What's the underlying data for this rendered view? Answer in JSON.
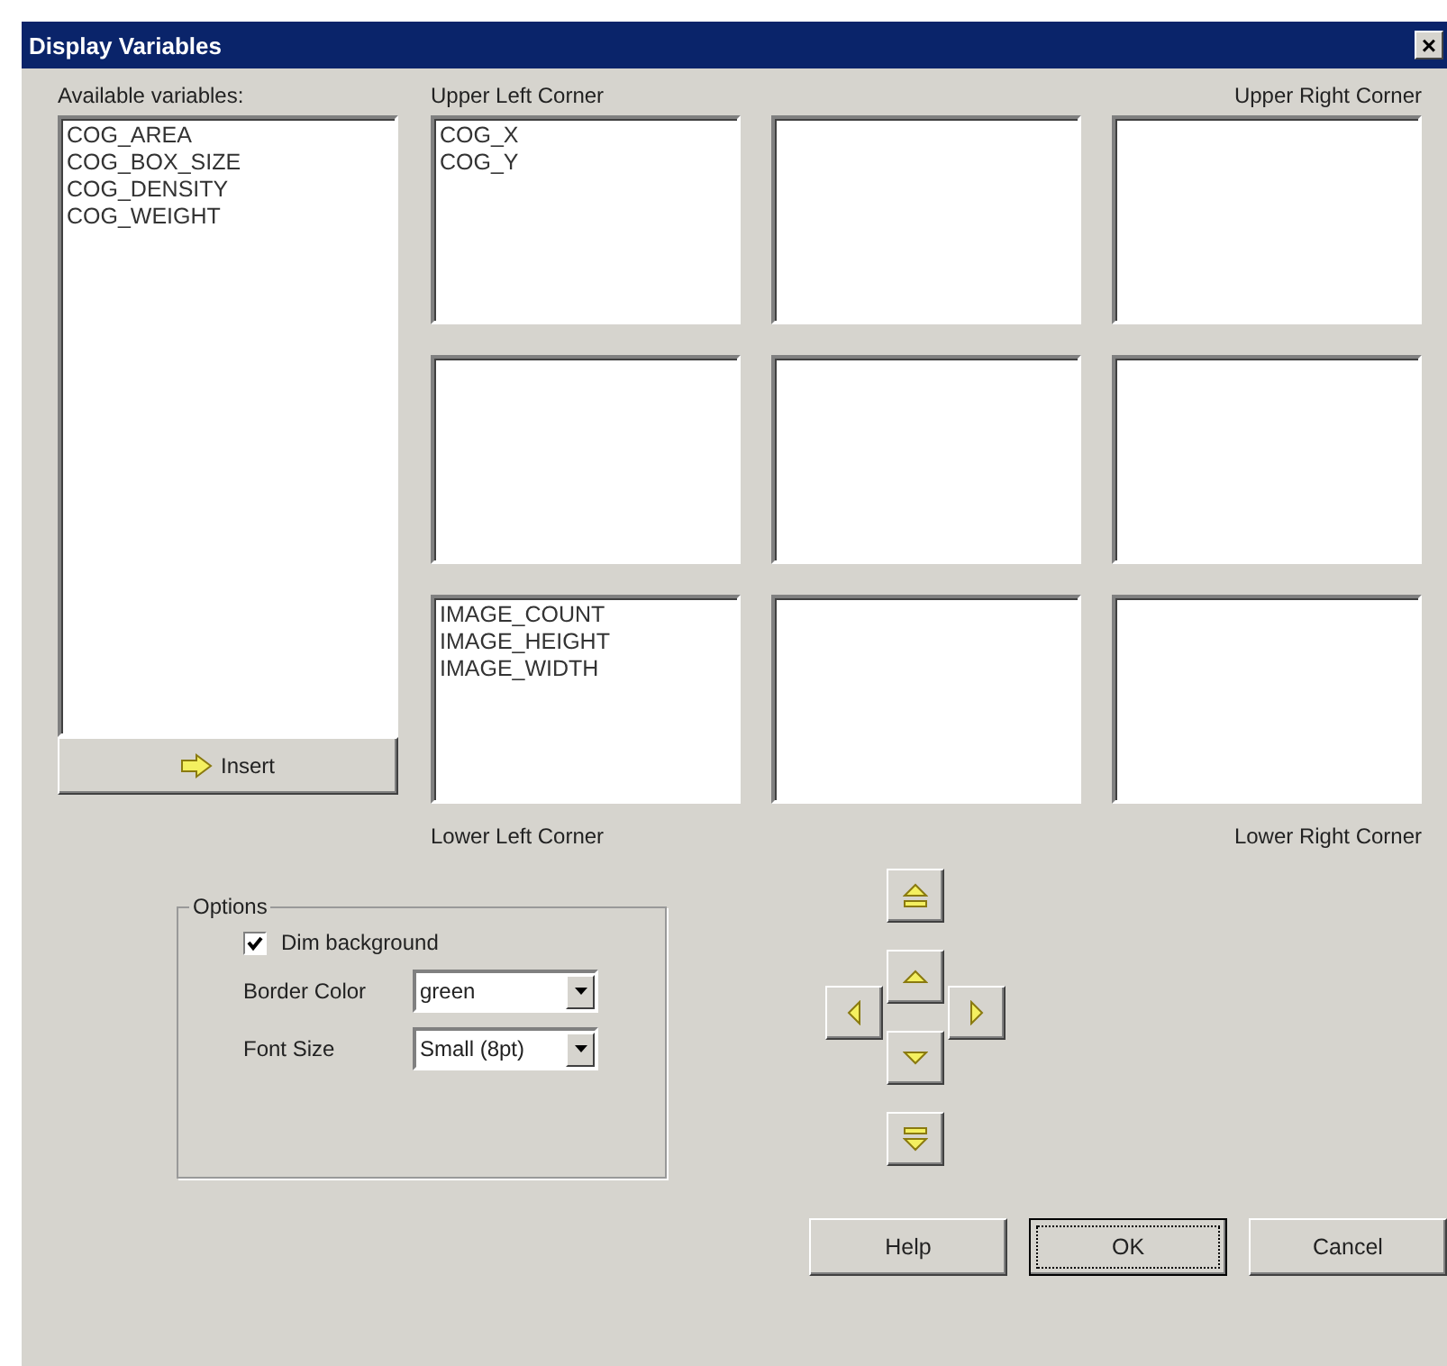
{
  "window": {
    "title": "Display Variables",
    "close": "×"
  },
  "available": {
    "label": "Available variables:",
    "items": [
      "COG_AREA",
      "COG_BOX_SIZE",
      "COG_DENSITY",
      "COG_WEIGHT"
    ],
    "insert_button": "Insert"
  },
  "corner_labels": {
    "upper_left": "Upper Left Corner",
    "upper_right": "Upper Right Corner",
    "lower_left": "Lower Left Corner",
    "lower_right": "Lower Right Corner"
  },
  "corner_lists": {
    "upper_left": [
      "COG_X",
      "COG_Y"
    ],
    "lower_left": [
      "IMAGE_COUNT",
      "IMAGE_HEIGHT",
      "IMAGE_WIDTH"
    ]
  },
  "options": {
    "title": "Options",
    "dim_background": {
      "label": "Dim background",
      "checked": true
    },
    "border_color": {
      "label": "Border Color",
      "value": "green"
    },
    "font_size": {
      "label": "Font Size",
      "value": "Small (8pt)"
    }
  },
  "move_buttons": [
    {
      "kind": "top"
    },
    {
      "kind": "up"
    },
    {
      "kind": "left"
    },
    {
      "kind": "right"
    },
    {
      "kind": "down"
    },
    {
      "kind": "bottom"
    }
  ],
  "buttons": [
    {
      "label": "Help",
      "focused": false
    },
    {
      "label": "OK",
      "focused": true
    },
    {
      "label": "Cancel",
      "focused": false
    }
  ]
}
